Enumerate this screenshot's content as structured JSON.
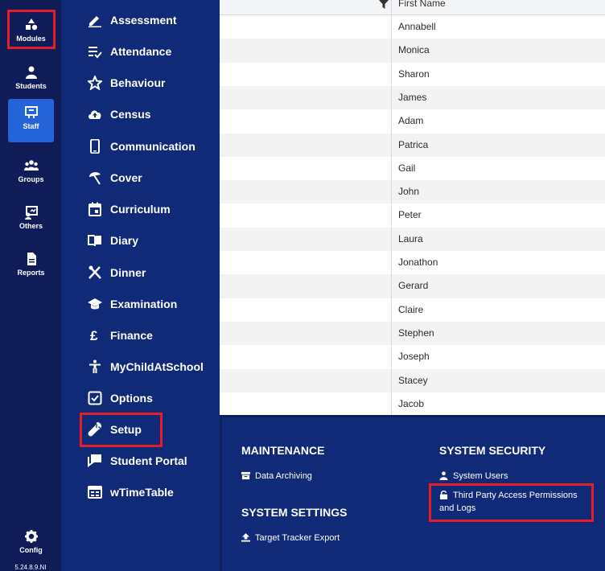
{
  "rail": {
    "items": [
      {
        "label": "Modules",
        "icon": "modules-icon"
      },
      {
        "label": "Students",
        "icon": "student-icon"
      },
      {
        "label": "Staff",
        "icon": "staff-icon"
      },
      {
        "label": "Groups",
        "icon": "groups-icon"
      },
      {
        "label": "Others",
        "icon": "others-icon"
      },
      {
        "label": "Reports",
        "icon": "reports-icon"
      }
    ],
    "config_label": "Config",
    "version": "5.24.8.9.NI"
  },
  "menu": {
    "items": [
      {
        "label": "Assessment",
        "icon": "pencil-icon"
      },
      {
        "label": "Attendance",
        "icon": "checklist-icon"
      },
      {
        "label": "Behaviour",
        "icon": "star-icon"
      },
      {
        "label": "Census",
        "icon": "cloud-upload-icon"
      },
      {
        "label": "Communication",
        "icon": "phone-icon"
      },
      {
        "label": "Cover",
        "icon": "umbrella-icon"
      },
      {
        "label": "Curriculum",
        "icon": "calendar-icon"
      },
      {
        "label": "Diary",
        "icon": "book-icon"
      },
      {
        "label": "Dinner",
        "icon": "cutlery-icon"
      },
      {
        "label": "Examination",
        "icon": "graduation-cap-icon"
      },
      {
        "label": "Finance",
        "icon": "pound-icon"
      },
      {
        "label": "MyChildAtSchool",
        "icon": "person-icon"
      },
      {
        "label": "Options",
        "icon": "checkbox-icon"
      },
      {
        "label": "Setup",
        "icon": "wrench-icon"
      },
      {
        "label": "Student Portal",
        "icon": "chat-icon"
      },
      {
        "label": "wTimeTable",
        "icon": "grid-icon"
      }
    ]
  },
  "grid": {
    "column_header": "First Name",
    "rows": [
      "Annabell",
      "Monica",
      "Sharon",
      "James",
      "Adam",
      "Patrica",
      "Gail",
      "John",
      "Peter",
      "Laura",
      "Jonathon",
      "Gerard",
      "Claire",
      "Stephen",
      "Joseph",
      "Stacey",
      "Jacob"
    ]
  },
  "setup_panel": {
    "maintenance_title": "MAINTENANCE",
    "data_archiving": "Data Archiving",
    "system_settings_title": "SYSTEM SETTINGS",
    "target_tracker_export": "Target Tracker Export",
    "system_security_title": "SYSTEM SECURITY",
    "system_users": "System Users",
    "third_party_line1": "Third Party Access Permissions",
    "third_party_line2": "and Logs"
  },
  "colors": {
    "rail_bg": "#0f1c57",
    "menu_bg": "#112a77",
    "active_blue": "#2563d9",
    "highlight_red": "#e41d2a"
  }
}
